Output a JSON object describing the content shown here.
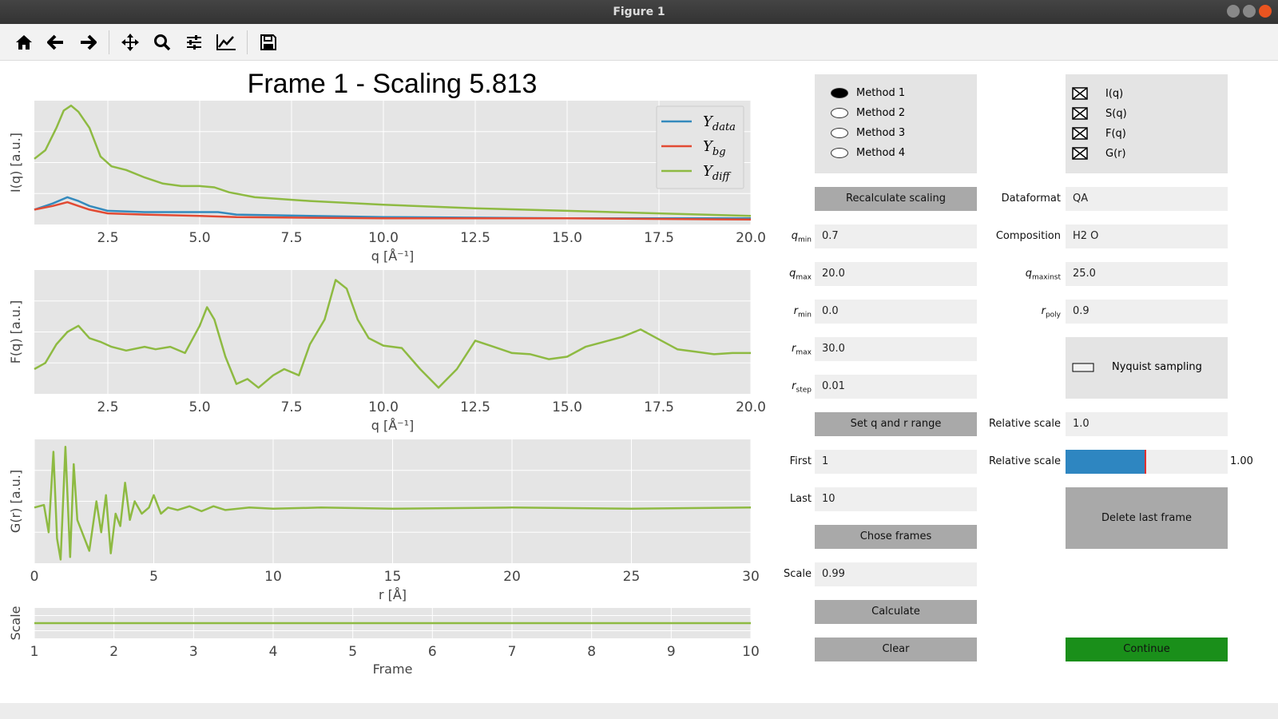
{
  "window": {
    "title": "Figure 1"
  },
  "toolbar": {
    "items": [
      "home-icon",
      "back-arrow-icon",
      "forward-arrow-icon",
      "pan-icon",
      "zoom-icon",
      "subplots-config-icon",
      "edit-axis-icon",
      "save-icon"
    ]
  },
  "plot": {
    "title": "Frame 1 - Scaling 5.813",
    "legend": [
      {
        "label": "Y",
        "sub": "data",
        "color": "#348abd"
      },
      {
        "label": "Y",
        "sub": "bg",
        "color": "#e24a33"
      },
      {
        "label": "Y",
        "sub": "diff",
        "color": "#8eba42"
      }
    ],
    "colors": {
      "data": "#348abd",
      "bg": "#e24a33",
      "diff": "#8eba42",
      "axes_bg": "#e5e5e5"
    }
  },
  "chart_data": [
    {
      "type": "line",
      "ylabel": "I(q) [a.u.]",
      "xlabel": "q [Å⁻¹]",
      "xlim": [
        0.5,
        20.0
      ],
      "xticks": [
        "2.5",
        "5.0",
        "7.5",
        "10.0",
        "12.5",
        "15.0",
        "17.5",
        "20.0"
      ],
      "series": [
        {
          "name": "Y_data",
          "x": [
            0.5,
            1.0,
            1.4,
            1.7,
            2.0,
            2.5,
            3.5,
            5.0,
            5.5,
            6.0,
            8.0,
            10.0,
            15.0,
            20.0
          ],
          "y": [
            0.12,
            0.17,
            0.22,
            0.19,
            0.15,
            0.11,
            0.1,
            0.1,
            0.1,
            0.08,
            0.07,
            0.06,
            0.05,
            0.05
          ]
        },
        {
          "name": "Y_bg",
          "x": [
            0.5,
            1.0,
            1.4,
            1.7,
            2.0,
            2.5,
            3.5,
            5.0,
            6.0,
            10.0,
            15.0,
            20.0
          ],
          "y": [
            0.12,
            0.15,
            0.18,
            0.15,
            0.12,
            0.09,
            0.08,
            0.07,
            0.06,
            0.05,
            0.05,
            0.04
          ]
        },
        {
          "name": "Y_diff",
          "x": [
            0.5,
            0.8,
            1.1,
            1.3,
            1.5,
            1.7,
            2.0,
            2.3,
            2.6,
            3.0,
            3.5,
            4.0,
            4.5,
            5.0,
            5.4,
            5.8,
            6.5,
            8.0,
            10.0,
            12.5,
            15.0,
            17.5,
            20.0
          ],
          "y": [
            0.53,
            0.6,
            0.78,
            0.92,
            0.96,
            0.91,
            0.78,
            0.55,
            0.47,
            0.44,
            0.38,
            0.33,
            0.31,
            0.31,
            0.3,
            0.26,
            0.22,
            0.19,
            0.16,
            0.13,
            0.11,
            0.09,
            0.07
          ]
        }
      ]
    },
    {
      "type": "line",
      "ylabel": "F(q) [a.u.]",
      "xlabel": "q [Å⁻¹]",
      "xlim": [
        0.5,
        20.0
      ],
      "xticks": [
        "2.5",
        "5.0",
        "7.5",
        "10.0",
        "12.5",
        "15.0",
        "17.5",
        "20.0"
      ],
      "series": [
        {
          "name": "Y_diff",
          "x": [
            0.5,
            0.8,
            1.1,
            1.4,
            1.7,
            2.0,
            2.3,
            2.6,
            3.0,
            3.5,
            3.8,
            4.2,
            4.6,
            5.0,
            5.2,
            5.4,
            5.7,
            6.0,
            6.3,
            6.6,
            7.0,
            7.3,
            7.7,
            8.0,
            8.4,
            8.7,
            9.0,
            9.3,
            9.6,
            10.0,
            10.5,
            11.0,
            11.5,
            12.0,
            12.5,
            13.0,
            13.5,
            14.0,
            14.5,
            15.0,
            15.5,
            16.0,
            16.5,
            17.0,
            17.5,
            18.0,
            18.5,
            19.0,
            19.5,
            20.0
          ],
          "y": [
            0.2,
            0.25,
            0.4,
            0.5,
            0.55,
            0.45,
            0.42,
            0.38,
            0.35,
            0.38,
            0.36,
            0.38,
            0.33,
            0.55,
            0.7,
            0.6,
            0.3,
            0.08,
            0.12,
            0.05,
            0.15,
            0.2,
            0.15,
            0.4,
            0.6,
            0.92,
            0.85,
            0.6,
            0.45,
            0.39,
            0.37,
            0.2,
            0.05,
            0.2,
            0.43,
            0.38,
            0.33,
            0.32,
            0.28,
            0.3,
            0.38,
            0.42,
            0.46,
            0.52,
            0.44,
            0.36,
            0.34,
            0.32,
            0.33,
            0.33
          ]
        }
      ]
    },
    {
      "type": "line",
      "ylabel": "G(r) [a.u.]",
      "xlabel": "r [Å]",
      "xlim": [
        0,
        30
      ],
      "xticks": [
        "0",
        "5",
        "10",
        "15",
        "20",
        "25",
        "30"
      ],
      "series": [
        {
          "name": "G(r)",
          "x": [
            0,
            0.4,
            0.6,
            0.8,
            0.95,
            1.1,
            1.3,
            1.5,
            1.65,
            1.8,
            2.0,
            2.3,
            2.6,
            2.8,
            3.0,
            3.2,
            3.4,
            3.6,
            3.8,
            4.0,
            4.2,
            4.5,
            4.8,
            5.0,
            5.3,
            5.6,
            6.0,
            6.5,
            7.0,
            7.5,
            8.0,
            9.0,
            10.0,
            12.0,
            15.0,
            20.0,
            25.0,
            30.0
          ],
          "y": [
            0.45,
            0.47,
            0.25,
            0.9,
            0.2,
            0.03,
            0.94,
            0.05,
            0.8,
            0.35,
            0.25,
            0.1,
            0.5,
            0.25,
            0.55,
            0.08,
            0.4,
            0.3,
            0.65,
            0.35,
            0.5,
            0.4,
            0.45,
            0.55,
            0.4,
            0.45,
            0.43,
            0.46,
            0.42,
            0.46,
            0.43,
            0.45,
            0.44,
            0.45,
            0.44,
            0.45,
            0.44,
            0.45
          ]
        }
      ]
    },
    {
      "type": "line",
      "ylabel": "Scale",
      "xlabel": "Frame",
      "xlim": [
        1,
        10
      ],
      "xticks": [
        "1",
        "2",
        "3",
        "4",
        "5",
        "6",
        "7",
        "8",
        "9",
        "10"
      ],
      "series": [
        {
          "name": "Scale",
          "x": [
            1,
            10
          ],
          "y": [
            0.5,
            0.5
          ]
        }
      ]
    }
  ],
  "controls": {
    "methods": [
      "Method 1",
      "Method 2",
      "Method 3",
      "Method 4"
    ],
    "selected_method": "Method 1",
    "outputs": [
      "I(q)",
      "S(q)",
      "F(q)",
      "G(r)"
    ],
    "recalc_label": "Recalculate scaling",
    "dataformat_label": "Dataformat",
    "dataformat": "QA",
    "composition_label": "Composition",
    "composition": "H2 O",
    "qmin_label": "q",
    "qmin_sub": "min",
    "qmin": "0.7",
    "qmax_label": "q",
    "qmax_sub": "max",
    "qmax": "20.0",
    "qmaxinst_label": "q",
    "qmaxinst_sub": "maxinst",
    "qmaxinst": "25.0",
    "rmin_label": "r",
    "rmin_sub": "min",
    "rmin": "0.0",
    "rpoly_label": "r",
    "rpoly_sub": "poly",
    "rpoly": "0.9",
    "rmax_label": "r",
    "rmax_sub": "max",
    "rmax": "30.0",
    "rstep_label": "r",
    "rstep_sub": "step",
    "rstep": "0.01",
    "nyquist_label": "Nyquist sampling",
    "setrange_label": "Set q and r range",
    "relscale_label": "Relative scale",
    "relscale": "1.0",
    "relscale_slider_label": "Relative scale",
    "relscale_slider_value": "1.00",
    "relscale_fraction": 0.49,
    "first_label": "First",
    "first": "1",
    "last_label": "Last",
    "last": "10",
    "delete_label": "Delete last frame",
    "chose_label": "Chose frames",
    "scale_label": "Scale",
    "scale": "0.99",
    "calculate_label": "Calculate",
    "clear_label": "Clear",
    "continue_label": "Continue",
    "continue_color": "#1a8f1a"
  }
}
